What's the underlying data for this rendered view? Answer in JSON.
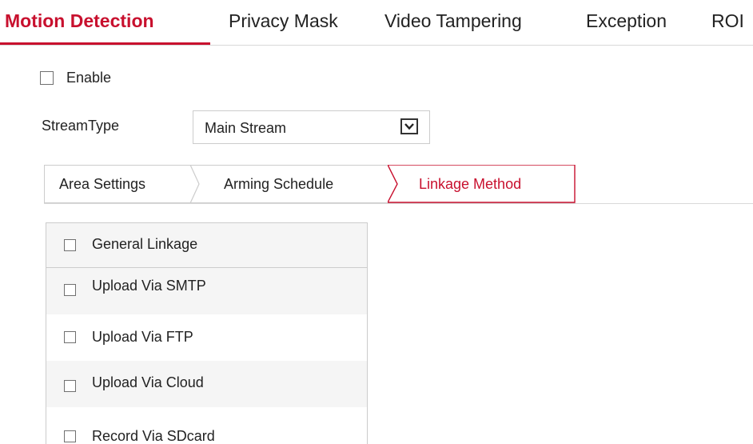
{
  "top_tabs": [
    {
      "label": "Motion Detection",
      "active": true
    },
    {
      "label": "Privacy Mask",
      "active": false
    },
    {
      "label": "Video Tampering",
      "active": false
    },
    {
      "label": "Exception",
      "active": false
    },
    {
      "label": "ROI",
      "active": false
    }
  ],
  "enable": {
    "label": "Enable",
    "checked": false
  },
  "stream_type": {
    "label": "StreamType",
    "selected": "Main Stream",
    "icon": "chevron-down-icon"
  },
  "sub_tabs": [
    {
      "label": "Area Settings",
      "active": false
    },
    {
      "label": "Arming Schedule",
      "active": false
    },
    {
      "label": "Linkage Method",
      "active": true
    }
  ],
  "linkage": {
    "header": {
      "label": "General Linkage",
      "checked": false
    },
    "items": [
      {
        "label": "Upload Via SMTP",
        "checked": false
      },
      {
        "label": "Upload Via FTP",
        "checked": false
      },
      {
        "label": "Upload Via Cloud",
        "checked": false
      },
      {
        "label": "Record Via SDcard",
        "checked": false
      }
    ]
  },
  "colors": {
    "accent": "#c8102e",
    "text": "#222222",
    "border": "#cccccc",
    "row_shade": "#f5f5f5"
  }
}
